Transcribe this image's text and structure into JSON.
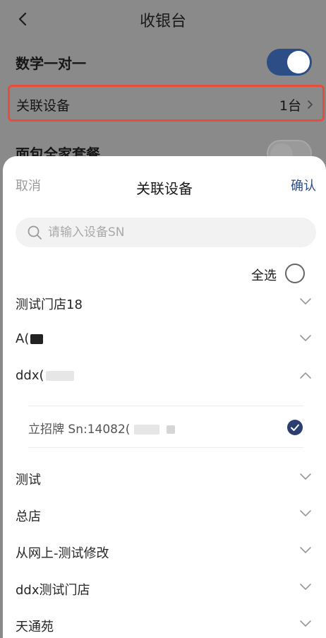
{
  "page": {
    "title": "收银台",
    "rows": [
      {
        "label": "数学一对一",
        "switch": "on"
      },
      {
        "label": "关联设备",
        "value": "1台"
      },
      {
        "label": "面包全家套餐",
        "switch": "off"
      }
    ]
  },
  "sheet": {
    "cancel": "取消",
    "title": "关联设备",
    "confirm": "确认",
    "search_placeholder": "请输入设备SN",
    "select_all": "全选",
    "stores": [
      {
        "name": "测试门店18",
        "expanded": false
      },
      {
        "name": "A(",
        "expanded": false
      },
      {
        "name": "ddx(",
        "expanded": true
      },
      {
        "name": "测试",
        "expanded": false
      },
      {
        "name": "总店",
        "expanded": false
      },
      {
        "name": "从网上-测试修改",
        "expanded": false
      },
      {
        "name": "ddx测试门店",
        "expanded": false
      },
      {
        "name": "天通苑",
        "expanded": false
      }
    ],
    "device": {
      "name": "立招牌 Sn:14082(",
      "checked": true
    }
  },
  "colors": {
    "accent": "#2a4d8a",
    "highlight": "#e84c3d",
    "check": "#2c3e70"
  },
  "icons": {
    "back": "chevron-left-icon",
    "search": "search-icon",
    "expand": "chevron-down-icon",
    "collapse": "chevron-up-icon",
    "check": "check-circle-icon"
  }
}
